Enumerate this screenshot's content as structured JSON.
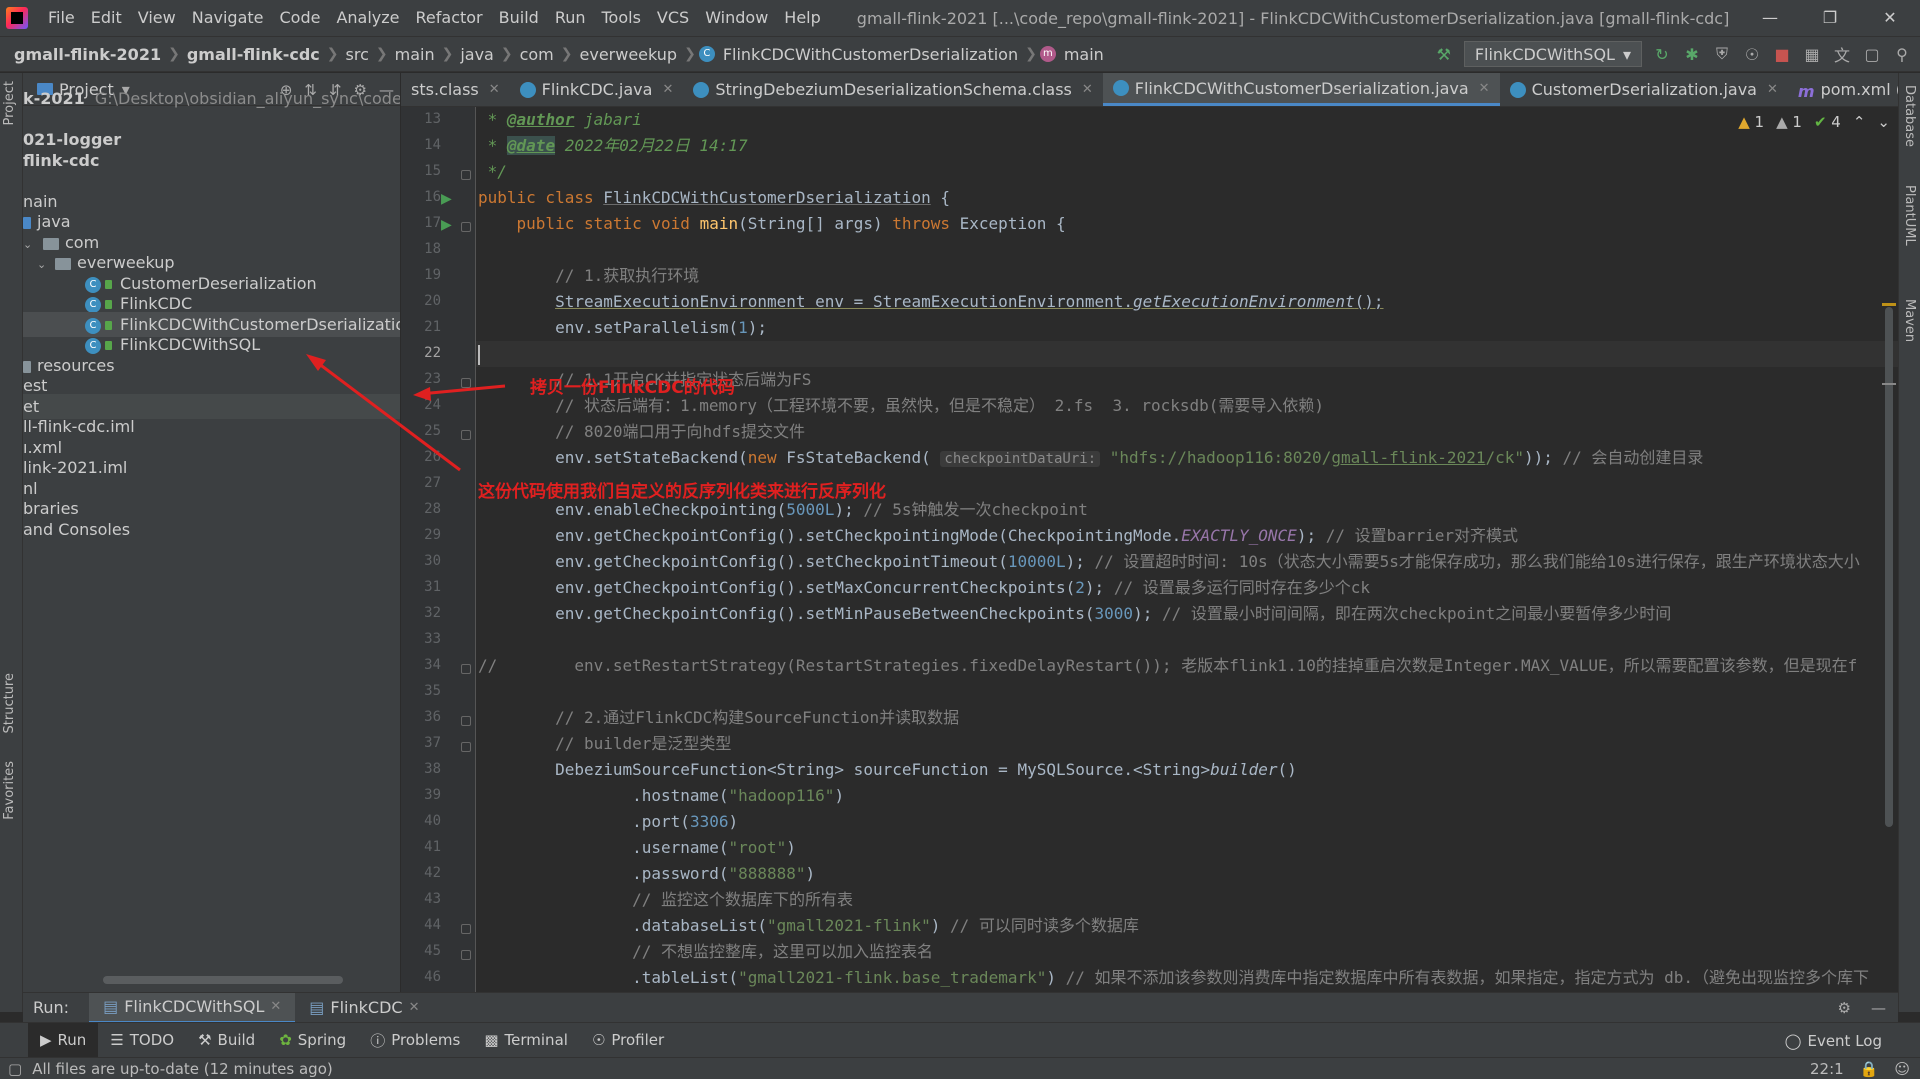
{
  "menu": [
    "File",
    "Edit",
    "View",
    "Navigate",
    "Code",
    "Analyze",
    "Refactor",
    "Build",
    "Run",
    "Tools",
    "VCS",
    "Window",
    "Help"
  ],
  "window_title": "gmall-flink-2021 [...\\code_repo\\gmall-flink-2021] - FlinkCDCWithCustomerDserialization.java [gmall-flink-cdc]",
  "breadcrumbs": [
    "gmall-flink-2021",
    "gmall-flink-cdc",
    "src",
    "main",
    "java",
    "com",
    "everweekup",
    "FlinkCDCWithCustomerDserialization",
    "main"
  ],
  "run_config": "FlinkCDCWithSQL",
  "project": {
    "header": "Project",
    "rows": [
      {
        "text": "k-2021",
        "path": "G:\\Desktop\\obsidian_aliyun_sync\\code_repo"
      },
      {
        "text": "021-logger"
      },
      {
        "text": "flink-cdc"
      },
      {
        "text": "nain"
      },
      {
        "text": "java"
      },
      {
        "text": "com"
      },
      {
        "text": "everweekup"
      },
      {
        "text": "CustomerDeserialization"
      },
      {
        "text": "FlinkCDC"
      },
      {
        "text": "FlinkCDCWithCustomerDserialization"
      },
      {
        "text": "FlinkCDCWithSQL"
      },
      {
        "text": "resources"
      },
      {
        "text": "est"
      },
      {
        "text": "et"
      },
      {
        "text": "ll-flink-cdc.iml"
      },
      {
        "text": "ı.xml"
      },
      {
        "text": "link-2021.iml"
      },
      {
        "text": "nl"
      },
      {
        "text": "braries"
      },
      {
        "text": "and Consoles"
      }
    ]
  },
  "editor_tabs": [
    "sts.class",
    "FlinkCDC.java",
    "StringDebeziumDeserializationSchema.class",
    "FlinkCDCWithCustomerDserialization.java",
    "CustomerDserialization.java",
    "pom.xml (gmall-flink-cd"
  ],
  "inspections": {
    "warn1": "1",
    "warn2": "1",
    "ok": "4"
  },
  "line_numbers": [
    "13",
    "14",
    "15",
    "16",
    "17",
    "18",
    "19",
    "20",
    "21",
    "22",
    "23",
    "24",
    "25",
    "26",
    "27",
    "28",
    "29",
    "30",
    "31",
    "32",
    "33",
    "34",
    "35",
    "36",
    "37",
    "38",
    "39",
    "40",
    "41",
    "42",
    "43",
    "44",
    "45",
    "46"
  ],
  "code": {
    "l13_tag": "@author",
    "l13_text": " jabari",
    "l14_tag": "@date",
    "l14_text": " 2022年02月22日 14:17",
    "l15": " */",
    "l16_a": "public class ",
    "l16_b": "FlinkCDCWithCustomerDserialization",
    "l16_c": " {",
    "l17_a": "    public static void ",
    "l17_b": "main",
    "l17_c": "(String[] args) ",
    "l17_d": "throws",
    "l17_e": " Exception {",
    "l19": "        // 1.获取执行环境",
    "l20_a": "StreamExecutionEnvironment",
    "l20_b": " env = ",
    "l20_c": "StreamExecutionEnvironment",
    "l20_d": ".",
    "l20_e": "getExecutionEnvironment",
    "l20_f": "();",
    "l21_a": "        env.",
    "l21_b": "setParallelism",
    "l21_c": "(",
    "l21_d": "1",
    "l21_e": ");",
    "l23": "        // 1.1开启CK并指定状态后端为FS",
    "l24": "        // 状态后端有：1.memory（工程环境不要，虽然快，但是不稳定） 2.fs  3. rocksdb(需要导入依赖)",
    "l25": "        // 8020端口用于向hdfs提交文件",
    "l26_a": "        env.",
    "l26_b": "setStateBackend",
    "l26_c": "(",
    "l26_d": "new ",
    "l26_e": "FsStateBackend(",
    "l26_hint": "checkpointDataUri:",
    "l26_f": "\"hdfs://hadoop116:8020/",
    "l26_g": "gmall-flink-2021",
    "l26_h": "/ck\"",
    "l26_i": ")); ",
    "l26_cm": "// 会自动创建目录",
    "l28_a": "        env.",
    "l28_b": "enableCheckpointing",
    "l28_c": "(",
    "l28_d": "5000L",
    "l28_e": "); ",
    "l28_cm": "// 5s钟触发一次checkpoint",
    "l29_a": "        env.",
    "l29_b": "getCheckpointConfig",
    "l29_c": "().",
    "l29_d": "setCheckpointingMode",
    "l29_e": "(CheckpointingMode.",
    "l29_f": "EXACTLY_ONCE",
    "l29_g": "); ",
    "l29_cm": "// 设置barrier对齐模式",
    "l30_a": "        env.",
    "l30_b": "getCheckpointConfig",
    "l30_c": "().",
    "l30_d": "setCheckpointTimeout",
    "l30_e": "(",
    "l30_f": "10000L",
    "l30_g": "); ",
    "l30_cm": "// 设置超时时间: 10s（状态大小需要5s才能保存成功，那么我们能给10s进行保存，跟生产环境状态大小",
    "l31_a": "        env.",
    "l31_b": "getCheckpointConfig",
    "l31_c": "().",
    "l31_d": "setMaxConcurrentCheckpoints",
    "l31_e": "(",
    "l31_f": "2",
    "l31_g": "); ",
    "l31_cm": "// 设置最多运行同时存在多少个ck",
    "l32_a": "        env.",
    "l32_b": "getCheckpointConfig",
    "l32_c": "().",
    "l32_d": "setMinPauseBetweenCheckpoints",
    "l32_e": "(",
    "l32_f": "3000",
    "l32_g": "); ",
    "l32_cm": "// 设置最小时间间隔，即在两次checkpoint之间最小要暂停多少时间",
    "l34": "//        env.setRestartStrategy(RestartStrategies.fixedDelayRestart()); 老版本flink1.10的挂掉重启次数是Integer.MAX_VALUE，所以需要配置该参数，但是现在f",
    "l36": "        // 2.通过FlinkCDC构建SourceFunction并读取数据",
    "l37": "        // builder是泛型类型",
    "l38_a": "        DebeziumSourceFunction",
    "l38_b": "<String> sourceFunction = ",
    "l38_c": "MySQLSource",
    "l38_d": ".<String>",
    "l38_e": "builder",
    "l38_f": "()",
    "l39_a": "                .",
    "l39_b": "hostname",
    "l39_c": "(",
    "l39_d": "\"hadoop116\"",
    "l39_e": ")",
    "l40_a": "                .",
    "l40_b": "port",
    "l40_c": "(",
    "l40_d": "3306",
    "l40_e": ")",
    "l41_a": "                .",
    "l41_b": "username",
    "l41_c": "(",
    "l41_d": "\"root\"",
    "l41_e": ")",
    "l42_a": "                .",
    "l42_b": "password",
    "l42_c": "(",
    "l42_d": "\"888888\"",
    "l42_e": ")",
    "l43": "                // 监控这个数据库下的所有表",
    "l44_a": "                .",
    "l44_b": "databaseList",
    "l44_c": "(",
    "l44_d": "\"gmall2021-flink\"",
    "l44_e": ") ",
    "l44_cm": "// 可以同时读多个数据库",
    "l45": "                // 不想监控整库，这里可以加入监控表名",
    "l46_a": "                .",
    "l46_b": "tableList",
    "l46_c": "(",
    "l46_d": "\"gmall2021-flink.base_trademark\"",
    "l46_e": ") ",
    "l46_cm": "// 如果不添加该参数则消费库中指定数据库中所有表数据，如果指定，指定方式为 db.（避免出现监控多个库下"
  },
  "annotations": {
    "a1": "拷贝一份FlinkCDC的代码",
    "a2": "这份代码使用我们自定义的反序列化类来进行反序列化"
  },
  "run": {
    "label": "Run:",
    "tabs": [
      "FlinkCDCWithSQL",
      "FlinkCDC"
    ]
  },
  "tool_windows": [
    "Run",
    "TODO",
    "Build",
    "Spring",
    "Problems",
    "Terminal",
    "Profiler"
  ],
  "event_log": "Event Log",
  "status": {
    "text": "All files are up-to-date (12 minutes ago)",
    "position": "22:1"
  },
  "side_tabs": {
    "left": [
      "Project",
      "Structure",
      "Favorites"
    ],
    "right": [
      "Database",
      "PlantUML",
      "Maven"
    ]
  }
}
